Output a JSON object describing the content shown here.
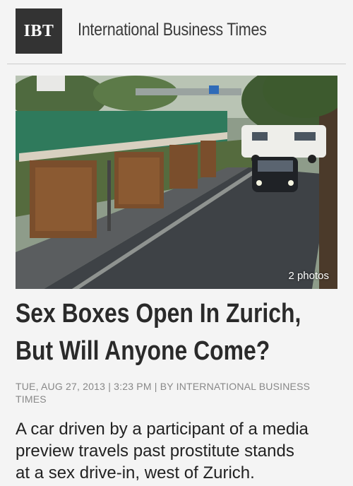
{
  "header": {
    "logo_text": "IBT",
    "site_name": "International Business Times"
  },
  "photo": {
    "count_label": "2 photos"
  },
  "article": {
    "headline_line1": "Sex Boxes Open In Zurich,",
    "headline_line2": "But Will Anyone Come?",
    "meta": "TUE, AUG 27, 2013 | 3:23 PM | BY INTERNATIONAL BUSINESS TIMES",
    "caption_line1": "A car driven by a participant of a media",
    "caption_line2": "preview travels past prostitute stands",
    "caption_line3": "at a sex drive-in, west of Zurich."
  },
  "colors": {
    "logo_bg": "#333333",
    "page_bg": "#f4f4f4",
    "meta_text": "#888888"
  }
}
